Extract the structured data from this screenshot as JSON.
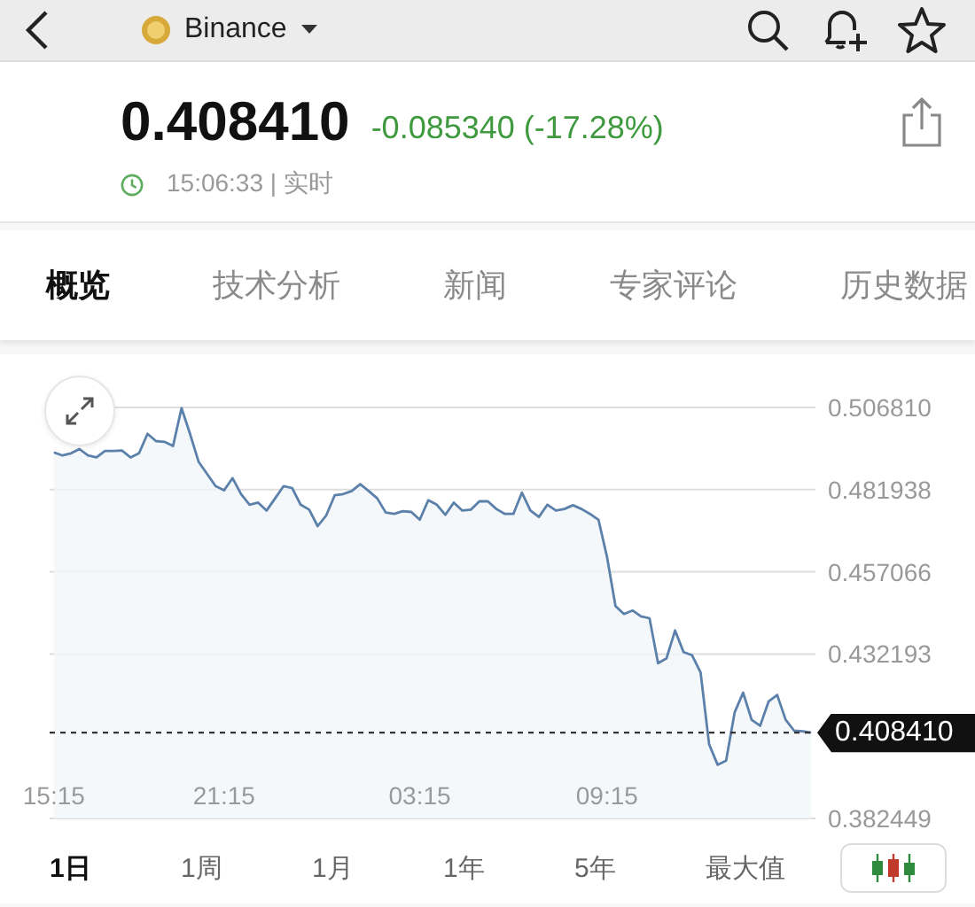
{
  "header": {
    "exchange": "Binance"
  },
  "quote": {
    "price": "0.408410",
    "change": "-0.085340 (-17.28%)",
    "time": "15:06:33 | 实时"
  },
  "tabs": [
    {
      "label": "概览",
      "selected": true
    },
    {
      "label": "技术分析",
      "selected": false
    },
    {
      "label": "新闻",
      "selected": false
    },
    {
      "label": "专家评论",
      "selected": false
    },
    {
      "label": "历史数据",
      "selected": false
    }
  ],
  "chart": {
    "chart_data": {
      "type": "area",
      "categories": [
        "15:15",
        null,
        null,
        null,
        null,
        null,
        null,
        null,
        null,
        null,
        null,
        null,
        null,
        null,
        null,
        null,
        null,
        null,
        null,
        null,
        "21:15",
        null,
        null,
        null,
        null,
        null,
        null,
        null,
        null,
        null,
        null,
        null,
        null,
        null,
        null,
        null,
        null,
        null,
        null,
        null,
        null,
        null,
        null,
        "03:15",
        null,
        null,
        null,
        null,
        null,
        null,
        null,
        null,
        null,
        null,
        null,
        null,
        null,
        null,
        null,
        null,
        null,
        null,
        null,
        null,
        null,
        "09:15",
        null,
        null,
        null,
        null,
        null,
        null,
        null,
        null,
        null,
        null,
        null,
        null,
        null,
        null,
        null,
        null,
        null,
        null,
        null,
        null,
        null,
        null,
        null,
        null
      ],
      "grid": true,
      "series": [
        {
          "color": "#5b80aa",
          "values": [
            0.4932,
            0.4923,
            0.4929,
            0.4942,
            0.4923,
            0.4917,
            0.4936,
            0.4936,
            0.4938,
            0.4917,
            0.4929,
            0.4988,
            0.4966,
            0.4964,
            0.4951,
            0.5066,
            0.4988,
            0.4904,
            0.4867,
            0.483,
            0.4817,
            0.4854,
            0.4806,
            0.4774,
            0.478,
            0.4756,
            0.4793,
            0.483,
            0.4824,
            0.4774,
            0.4759,
            0.4709,
            0.4741,
            0.4802,
            0.4806,
            0.4815,
            0.4836,
            0.4815,
            0.4793,
            0.475,
            0.4746,
            0.4754,
            0.4752,
            0.4728,
            0.4787,
            0.4774,
            0.4743,
            0.478,
            0.4756,
            0.4759,
            0.4784,
            0.4784,
            0.4761,
            0.4746,
            0.4746,
            0.481,
            0.4756,
            0.4737,
            0.4774,
            0.4756,
            0.4761,
            0.4772,
            0.4761,
            0.4746,
            0.4728,
            0.4616,
            0.4467,
            0.4443,
            0.4454,
            0.4436,
            0.443,
            0.4294,
            0.4309,
            0.4393,
            0.4328,
            0.4318,
            0.4266,
            0.4049,
            0.3987,
            0.3999,
            0.4145,
            0.4205,
            0.4123,
            0.4105,
            0.4179,
            0.4198,
            0.4123,
            0.409,
            0.4088,
            0.4084
          ]
        }
      ],
      "ylim": [
        0.382449,
        0.50681
      ],
      "yticks": [
        {
          "value": 0.50681,
          "label": "0.506810"
        },
        {
          "value": 0.481938,
          "label": "0.481938"
        },
        {
          "value": 0.457066,
          "label": "0.457066"
        },
        {
          "value": 0.432193,
          "label": "0.432193"
        },
        {
          "value": 0.382449,
          "label": "0.382449"
        }
      ],
      "ref_lines": [
        {
          "axis": "y",
          "value": 0.40841,
          "label": "0.408410"
        }
      ]
    }
  },
  "ranges": [
    {
      "label": "1日",
      "selected": true
    },
    {
      "label": "1周",
      "selected": false
    },
    {
      "label": "1月",
      "selected": false
    },
    {
      "label": "1年",
      "selected": false
    },
    {
      "label": "5年",
      "selected": false
    },
    {
      "label": "最大值",
      "selected": false
    }
  ]
}
